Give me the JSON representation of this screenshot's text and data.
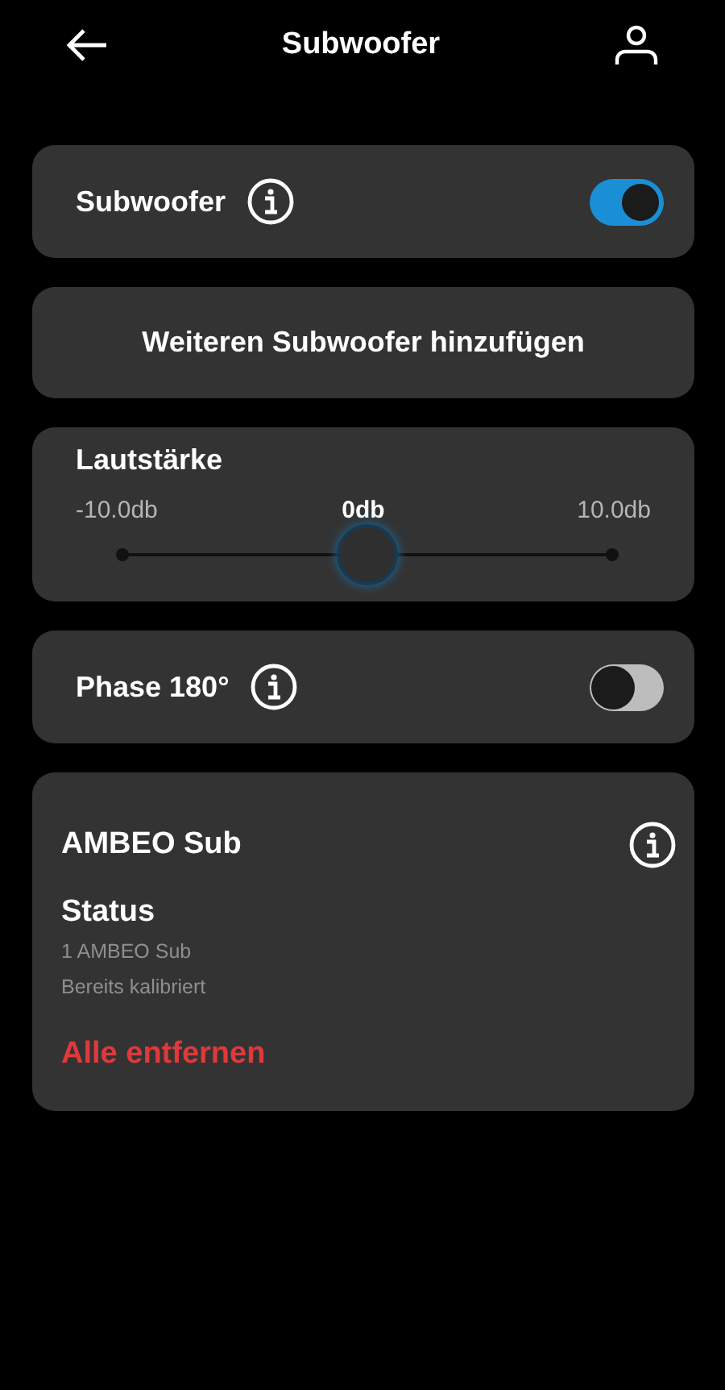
{
  "header": {
    "title": "Subwoofer"
  },
  "settings": [
    {
      "kind": "toggle",
      "label": "Subwoofer",
      "on": true
    },
    {
      "kind": "button",
      "label": "Weiteren Subwoofer hinzufügen"
    },
    {
      "kind": "slider",
      "label": "Lautstärke",
      "min_label": "-10.0db",
      "value_label": "0db",
      "max_label": "10.0db",
      "level": 0.5
    },
    {
      "kind": "toggle",
      "label": "Phase 180°",
      "on": false
    }
  ],
  "device": {
    "name": "AMBEO Sub",
    "status_title": "Status",
    "status_lines": [
      "1 AMBEO Sub",
      "Bereits kalibriert"
    ],
    "remove_label": "Alle entfernen"
  }
}
